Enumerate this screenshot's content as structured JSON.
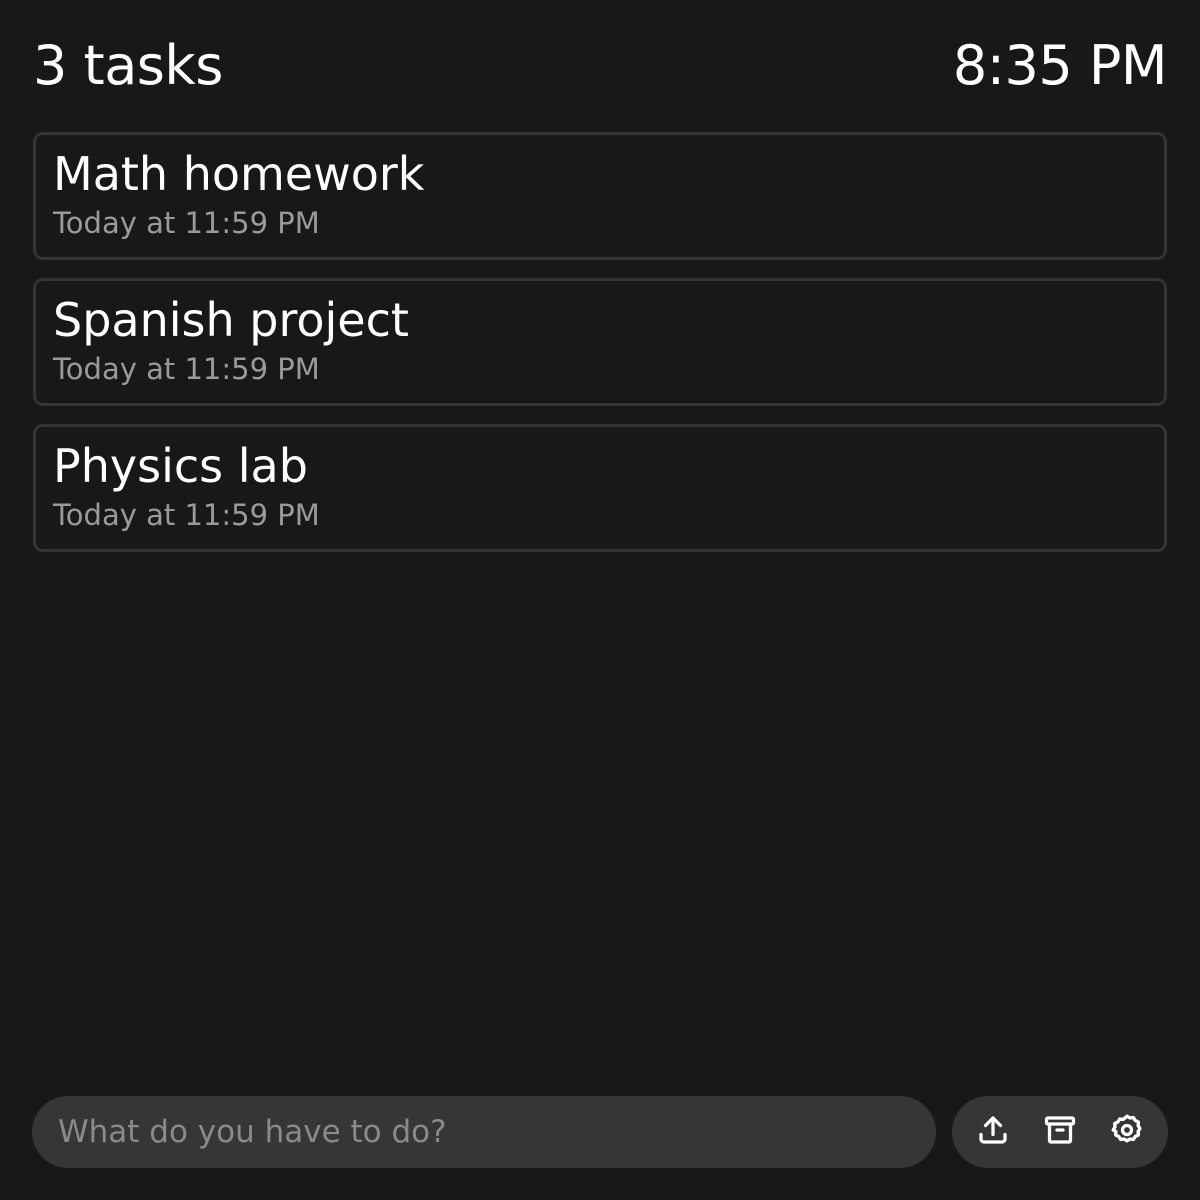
{
  "header": {
    "task_count": "3 tasks",
    "time": "8:35 PM"
  },
  "tasks": [
    {
      "title": "Math homework",
      "due": "Today at 11:59 PM"
    },
    {
      "title": "Spanish project",
      "due": "Today at 11:59 PM"
    },
    {
      "title": "Physics lab",
      "due": "Today at 11:59 PM"
    }
  ],
  "composer": {
    "placeholder": "What do you have to do?",
    "value": ""
  },
  "toolbar": {
    "icons": [
      "upload-icon",
      "archive-icon",
      "gear-icon"
    ]
  },
  "colors": {
    "background": "#181818",
    "card_border": "#343434",
    "pill_background": "#363636",
    "text_primary": "#ffffff",
    "text_secondary": "#9a9a9a"
  }
}
